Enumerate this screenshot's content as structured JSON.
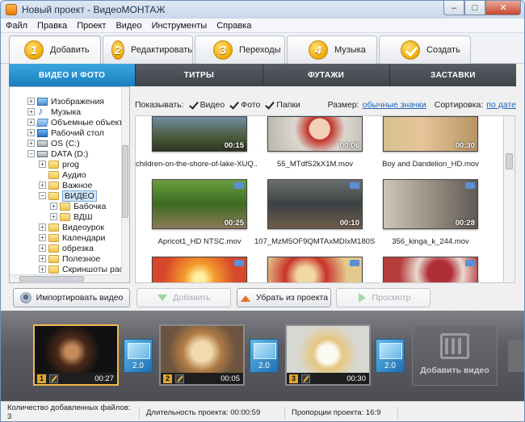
{
  "window": {
    "title": "Новый проект - ВидеоМОНТАЖ",
    "minimize": "–",
    "maximize": "□",
    "close": "✕"
  },
  "menu": [
    "Файл",
    "Правка",
    "Проект",
    "Видео",
    "Инструменты",
    "Справка"
  ],
  "steps": [
    {
      "num": "1",
      "label": "Добавить",
      "active": true
    },
    {
      "num": "2",
      "label": "Редактировать"
    },
    {
      "num": "3",
      "label": "Переходы"
    },
    {
      "num": "4",
      "label": "Музыка"
    },
    {
      "num": "",
      "label": "Создать",
      "icon": "check-icon"
    }
  ],
  "subtabs": [
    "ВИДЕО И ФОТО",
    "ТИТРЫ",
    "ФУТАЖИ",
    "ЗАСТАВКИ"
  ],
  "tree": [
    {
      "label": "Изображения",
      "icon": "pictures-icon",
      "expander": "+"
    },
    {
      "label": "Музыка",
      "icon": "music-icon",
      "expander": "+"
    },
    {
      "label": "Объемные объекты",
      "icon": "3d-objects-icon",
      "expander": "+"
    },
    {
      "label": "Рабочий стол",
      "icon": "desktop-icon",
      "expander": "+"
    },
    {
      "label": "OS (C:)",
      "icon": "drive-icon",
      "expander": "+"
    },
    {
      "label": "DATA (D:)",
      "icon": "drive-icon",
      "expander": "−"
    },
    {
      "label": "prog",
      "icon": "folder-icon",
      "expander": "+"
    },
    {
      "label": "Аудио",
      "icon": "folder-icon",
      "expander": ""
    },
    {
      "label": "Важное",
      "icon": "folder-icon",
      "expander": "+"
    },
    {
      "label": "ВИДЕО",
      "icon": "folder-icon",
      "expander": "−",
      "selected": true
    },
    {
      "label": "Бабочка",
      "icon": "folder-icon",
      "expander": "+"
    },
    {
      "label": "ВДШ",
      "icon": "folder-icon",
      "expander": "+"
    },
    {
      "label": "Видеоурок",
      "icon": "folder-icon",
      "expander": "+"
    },
    {
      "label": "Календари",
      "icon": "folder-icon",
      "expander": "+"
    },
    {
      "label": "обрезка",
      "icon": "folder-icon",
      "expander": "+"
    },
    {
      "label": "Полезное",
      "icon": "folder-icon",
      "expander": "+"
    },
    {
      "label": "Скриншоты рассь",
      "icon": "folder-icon",
      "expander": "+"
    }
  ],
  "filter": {
    "show_label": "Показывать:",
    "video": "Видео",
    "photo": "Фото",
    "folders": "Папки",
    "size_label": "Размер:",
    "size_value": "обычные значки",
    "sort_label": "Сортировка:",
    "sort_value": "по дате"
  },
  "files": [
    {
      "name": "children-on-the-shore-of-lake-XUQ...",
      "duration": "00:15"
    },
    {
      "name": "55_MTdfS2kX1M.mov",
      "duration": "00:06"
    },
    {
      "name": "Boy and Dandelion_HD.mov",
      "duration": "00:30"
    },
    {
      "name": "Apricot1_HD NTSC.mov",
      "duration": "00:25"
    },
    {
      "name": "107_MzM5OF9QMTAxMDIxM180S...",
      "duration": "00:10"
    },
    {
      "name": "356_kinga_k_244.mov",
      "duration": "00:28"
    },
    {
      "name": "",
      "duration": ""
    },
    {
      "name": "",
      "duration": ""
    },
    {
      "name": "",
      "duration": ""
    }
  ],
  "buttons": {
    "import": "Импортировать видео",
    "add": "Добавить",
    "remove": "Убрать из проекта",
    "preview": "Просмотр"
  },
  "timeline": {
    "clips": [
      {
        "num": "1",
        "duration": "00:27"
      },
      {
        "num": "2",
        "duration": "00:05"
      },
      {
        "num": "3",
        "duration": "00:30"
      }
    ],
    "transitions": [
      "2.0",
      "2.0",
      "2.0"
    ],
    "add_video": "Добавить видео"
  },
  "status": {
    "files_count": "Количество добавленных файлов: 3",
    "duration": "Длительность проекта: 00:00:59",
    "aspect": "Пропорции проекта: 16:9"
  }
}
